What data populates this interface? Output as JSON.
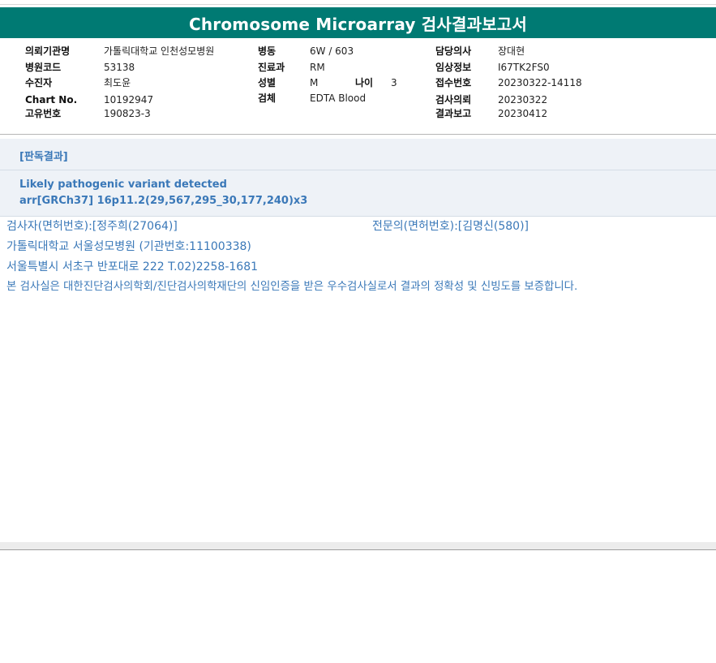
{
  "report": {
    "title": "Chromosome Microarray 검사결과보고서"
  },
  "info": {
    "left": [
      {
        "label": "의뢰기관명",
        "value": "가톨릭대학교 인천성모병원"
      },
      {
        "label": "병원코드",
        "value": "53138"
      },
      {
        "label": "수진자",
        "value": "최도윤"
      },
      {
        "label": "Chart No.",
        "value": "10192947"
      },
      {
        "label": "고유번호",
        "value": "190823-3"
      }
    ],
    "middle": [
      {
        "label": "병동",
        "value": "6W / 603"
      },
      {
        "label": "진료과",
        "value": "RM"
      },
      {
        "label": "성별",
        "value": "M"
      },
      {
        "label": "검체",
        "value": "EDTA Blood"
      }
    ],
    "age": {
      "label": "나이",
      "value": "3"
    },
    "right": [
      {
        "label": "담당의사",
        "value": "장대현"
      },
      {
        "label": "임상정보",
        "value": "I67TK2FS0"
      },
      {
        "label": "접수번호",
        "value": "20230322-14118"
      },
      {
        "label": "검사의뢰",
        "value": "20230322"
      },
      {
        "label": "결과보고",
        "value": "20230412"
      }
    ]
  },
  "result": {
    "heading": "[판독결과]",
    "line1": "Likely pathogenic variant detected",
    "line2": "arr[GRCh37] 16p11.2(29,567,295_30,177,240)x3"
  },
  "footer": {
    "examiner": "검사자(면허번호):[정주희(27064)]",
    "specialist": "전문의(면허번호):[김명신(580)]",
    "institution": "가톨릭대학교 서울성모병원 (기관번호:11100338)",
    "address": "서울특별시 서초구 반포대로 222 T.02)2258-1681",
    "certification": "본 검사실은 대한진단검사의학회/진단검사의학재단의 신임인증을 받은 우수검사실로서 결과의 정확성 및 신빙도를 보증합니다."
  }
}
